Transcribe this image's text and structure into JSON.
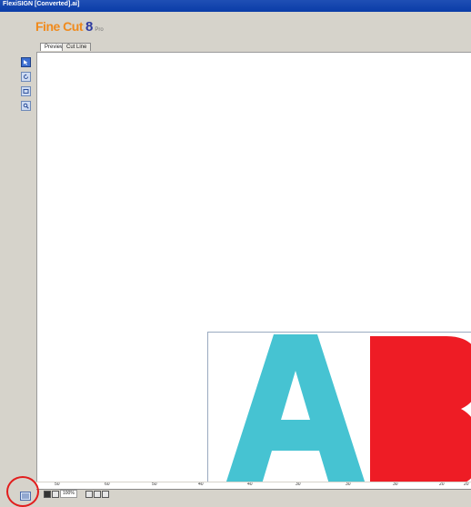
{
  "window": {
    "title": "FlexiSIGN [Converted].ai]"
  },
  "logo": {
    "text": "Fine Cut",
    "version": "8",
    "suffix": "Pro"
  },
  "tabs": [
    {
      "label": "Preview"
    },
    {
      "label": "Cut Line"
    }
  ],
  "toolbar": {
    "tools": [
      {
        "icon": "arrow-select-icon",
        "active": true
      },
      {
        "icon": "rotate-icon",
        "active": false
      },
      {
        "icon": "frame-icon",
        "active": false
      },
      {
        "icon": "zoom-icon",
        "active": false
      }
    ]
  },
  "artwork": {
    "letters": [
      {
        "char": "A",
        "color": "#46c3d2"
      },
      {
        "char": "B",
        "color": "#ee1c25"
      }
    ]
  },
  "ruler": {
    "labels": [
      "50",
      "60",
      "50",
      "40",
      "40",
      "30",
      "30",
      "30",
      "20",
      "20"
    ]
  },
  "status": {
    "zoom": "100%"
  },
  "annotation": {
    "highlight_color": "#e21d1d"
  }
}
